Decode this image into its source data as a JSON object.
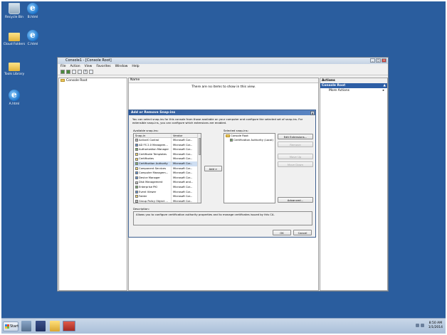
{
  "desktop": {
    "icons": [
      {
        "label": "Recycle Bin",
        "icon": "recycle-bin-icon"
      },
      {
        "label": "B.html",
        "icon": "ie-html-icon"
      },
      {
        "label": "Cloud Folders",
        "icon": "folder-icon"
      },
      {
        "label": "C.html",
        "icon": "ie-html-icon"
      },
      {
        "label": "Tools Library",
        "icon": "folder-icon"
      },
      {
        "label": "A.html",
        "icon": "ie-html-icon"
      }
    ]
  },
  "mmc": {
    "title": "Console1 - [Console Root]",
    "menu": [
      "File",
      "Action",
      "View",
      "Favorites",
      "Window",
      "Help"
    ],
    "tree_root": "Console Root",
    "centre_column": "Name",
    "empty_message": "There are no items to show in this view.",
    "actions_header": "Actions",
    "actions_section": "Console Root",
    "actions_items": [
      "More Actions"
    ]
  },
  "dialog": {
    "title": "Add or Remove Snap-ins",
    "intro": "You can select snap-ins for this console from those available on your computer and configure the selected set of snap-ins. For extensible snap-ins, you can configure which extensions are enabled.",
    "available_label": "Available snap-ins:",
    "selected_label": "Selected snap-ins:",
    "columns": {
      "snapin": "Snap-in",
      "vendor": "Vendor"
    },
    "available": [
      {
        "name": "ActiveX Control",
        "vendor": "Microsoft Cor...",
        "icon": "gry"
      },
      {
        "name": "AD FS 2.0 Managem...",
        "vendor": "Microsoft Cor...",
        "icon": "blue"
      },
      {
        "name": "Authorization Manager",
        "vendor": "Microsoft Cor...",
        "icon": "grn"
      },
      {
        "name": "Certificate Templates",
        "vendor": "Microsoft Cor...",
        "icon": "yel"
      },
      {
        "name": "Certificates",
        "vendor": "Microsoft Cor...",
        "icon": "yel"
      },
      {
        "name": "Certification Authority",
        "vendor": "Microsoft Cor...",
        "icon": "grn",
        "selected": true
      },
      {
        "name": "Component Services",
        "vendor": "Microsoft Cor...",
        "icon": "yel"
      },
      {
        "name": "Computer Managem...",
        "vendor": "Microsoft Cor...",
        "icon": "blue"
      },
      {
        "name": "Device Manager",
        "vendor": "Microsoft Cor...",
        "icon": "blue"
      },
      {
        "name": "Disk Management",
        "vendor": "Microsoft and...",
        "icon": "gry"
      },
      {
        "name": "Enterprise PKI",
        "vendor": "Microsoft Cor...",
        "icon": "grn"
      },
      {
        "name": "Event Viewer",
        "vendor": "Microsoft Cor...",
        "icon": "blue"
      },
      {
        "name": "Folder",
        "vendor": "Microsoft Cor...",
        "icon": "yel"
      },
      {
        "name": "Group Policy Object ...",
        "vendor": "Microsoft Cor...",
        "icon": "gry"
      }
    ],
    "selected_root": "Console Root",
    "selected_child": "Certification Authority (Local)",
    "add_button": "Add >",
    "buttons": {
      "edit_extensions": "Edit Extensions...",
      "remove": "Remove",
      "move_up": "Move Up",
      "move_down": "Move Down",
      "advanced": "Advanced...",
      "ok": "OK",
      "cancel": "Cancel"
    },
    "description_label": "Description:",
    "description": "Allows you to configure certification authority properties and to manage certificates issued by this CA."
  },
  "taskbar": {
    "start": "Start",
    "clock_time": "8:50 AM",
    "clock_date": "1/1/2014"
  }
}
